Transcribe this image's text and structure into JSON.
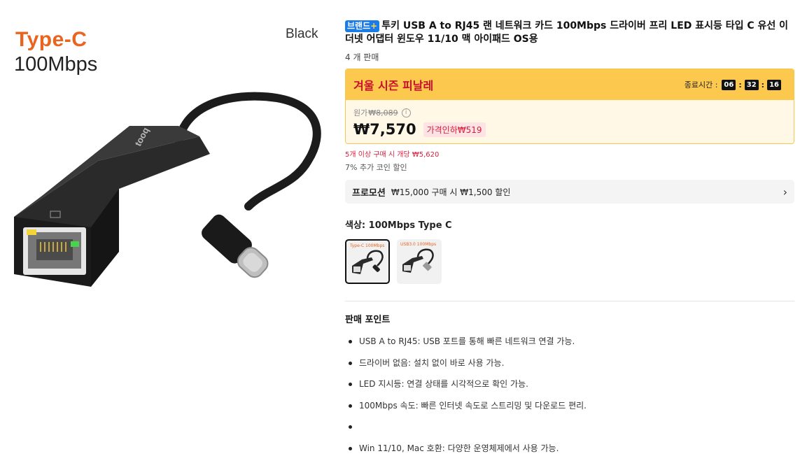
{
  "hero": {
    "type_label": "Type-C",
    "speed_label": "100Mbps",
    "color_label": "Black",
    "brand_text": "tooq"
  },
  "product": {
    "badge_text": "브랜드",
    "badge_plus": "+",
    "title": "투키 USB A to RJ45 랜 네트워크 카드 100Mbps 드라이버 프리 LED 표시등 타입 C 유선 이더넷 어댑터 윈도우 11/10 맥 아이패드 OS용",
    "sold": "4 개 판매"
  },
  "sale": {
    "title": "겨울 시즌 피날레",
    "timer_label": "종료시간 :",
    "hours": "06",
    "minutes": "32",
    "seconds": "16",
    "original_label": "원가",
    "original_price": "₩8,089",
    "info_icon_glyph": "i",
    "price": "₩7,570",
    "price_cut": "가격인하₩519"
  },
  "bulk_text": "5개 이상 구매 시 개당 ₩5,620",
  "coin_text": "7% 추가 코인 할인",
  "promo": {
    "tag": "프로모션",
    "text": "₩15,000 구매 시 ₩1,500 할인",
    "chevron": "›"
  },
  "color_option": {
    "label": "색상: 100Mbps Type C",
    "swatches": [
      {
        "mini_label": "Type-C 100Mbps",
        "selected": true
      },
      {
        "mini_label": "USB3.0 100Mbps",
        "selected": false
      }
    ]
  },
  "selling_points": {
    "title": "판매 포인트",
    "items": [
      "USB A to RJ45: USB 포트를 통해 빠른 네트워크 연결 가능.",
      "드라이버 없음: 설치 없이 바로 사용 가능.",
      "LED 지시등: 연결 상태를 시각적으로 확인 가능.",
      "100Mbps 속도: 빠른 인터넷 속도로 스트리밍 및 다운로드 편리.",
      "",
      "Win 11/10, Mac 호환: 다양한 운영체제에서 사용 가능."
    ]
  },
  "colors": {
    "accent_orange": "#e8641f",
    "sale_yellow": "#fdc84e",
    "sale_red": "#c8102e",
    "brand_blue": "#1b7ce8"
  }
}
